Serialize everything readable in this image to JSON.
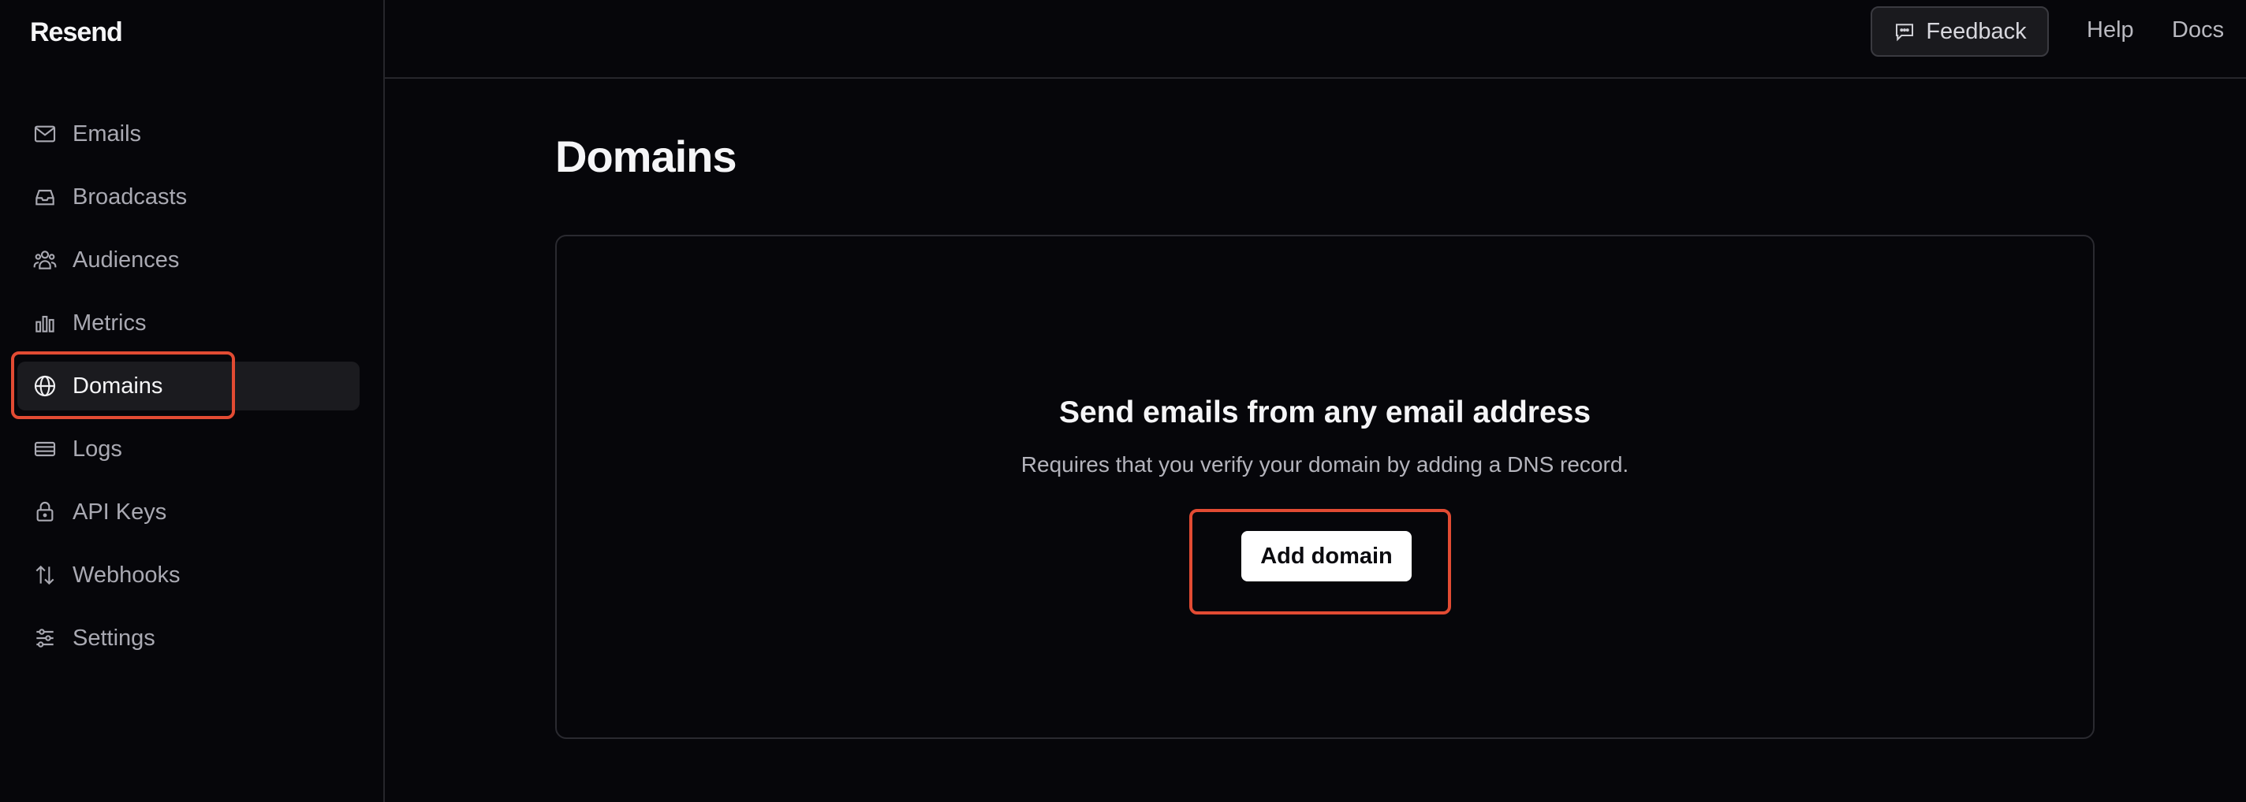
{
  "app": {
    "name": "Resend"
  },
  "sidebar": {
    "items": [
      {
        "label": "Emails",
        "icon": "mail-icon"
      },
      {
        "label": "Broadcasts",
        "icon": "inbox-icon"
      },
      {
        "label": "Audiences",
        "icon": "users-icon"
      },
      {
        "label": "Metrics",
        "icon": "bar-chart-icon"
      },
      {
        "label": "Domains",
        "icon": "globe-icon",
        "active": true
      },
      {
        "label": "Logs",
        "icon": "logs-icon"
      },
      {
        "label": "API Keys",
        "icon": "lock-icon"
      },
      {
        "label": "Webhooks",
        "icon": "arrows-icon"
      },
      {
        "label": "Settings",
        "icon": "sliders-icon"
      }
    ]
  },
  "topbar": {
    "feedback_label": "Feedback",
    "help_label": "Help",
    "docs_label": "Docs"
  },
  "main": {
    "title": "Domains",
    "empty_state": {
      "title": "Send emails from any email address",
      "subtitle": "Requires that you verify your domain by adding a DNS record.",
      "button_label": "Add domain"
    }
  },
  "colors": {
    "background": "#06060a",
    "accent_highlight": "#e24b33",
    "primary_button": "#ffffff"
  }
}
